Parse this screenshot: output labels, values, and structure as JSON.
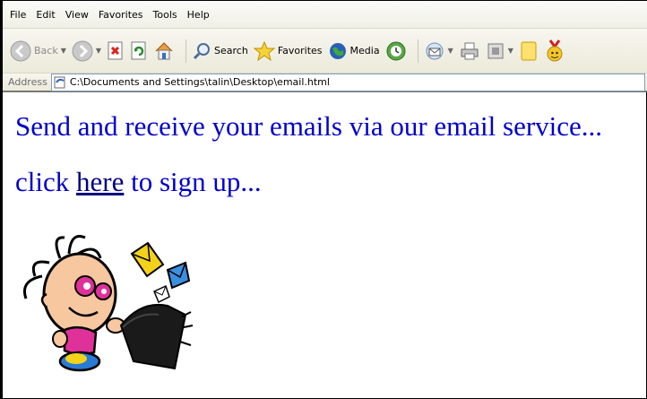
{
  "menu": [
    "File",
    "Edit",
    "View",
    "Favorites",
    "Tools",
    "Help"
  ],
  "toolbar": {
    "back_label": "Back",
    "search_label": "Search",
    "favorites_label": "Favorites",
    "media_label": "Media"
  },
  "address": {
    "label": "Address",
    "value": "C:\\Documents and Settings\\talin\\Desktop\\email.html"
  },
  "content": {
    "headline": "Send and receive your emails via our email service...",
    "line2_before": "click ",
    "link_text": "here",
    "line2_after": " to sign up..."
  },
  "colors": {
    "text": "#0000cc",
    "link": "#000080"
  },
  "icons": [
    "back-arrow-icon",
    "forward-arrow-icon",
    "stop-icon",
    "refresh-icon",
    "home-icon",
    "search-icon",
    "favorites-star-icon",
    "media-icon",
    "history-icon",
    "mail-icon",
    "print-icon",
    "edit-icon",
    "messenger-icon",
    "page-icon"
  ]
}
